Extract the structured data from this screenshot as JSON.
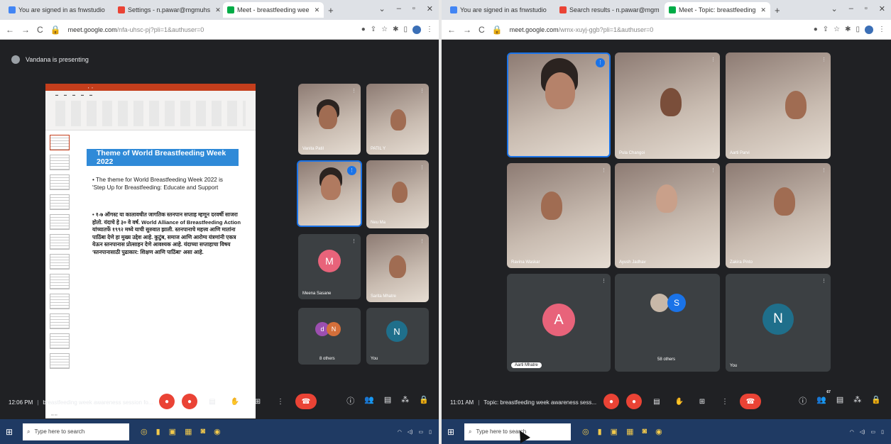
{
  "colors": {
    "meet_bg": "#202124",
    "accent": "#1a73e8",
    "end_call": "#ea4335",
    "slide_banner": "#2f8ad8",
    "taskbar": "#1f3a63"
  },
  "left": {
    "tabs": [
      {
        "label": "You are signed in as fnwstudio",
        "icon": "google-icon"
      },
      {
        "label": "Settings - n.pawar@mgmuhs",
        "icon": "gmail-icon"
      },
      {
        "label": "Meet - breastfeeding wee",
        "icon": "meet-icon"
      }
    ],
    "url": "meet.google.com",
    "url_path": "/nfa-uhsc-pj?pli=1&authuser=0",
    "presenting_text": "Vandana is presenting",
    "slide": {
      "title": "Theme of World Breastfeeding Week 2022",
      "bullet1": "• The theme for World Breastfeeding Week 2022 is 'Step Up for Breastfeeding: Educate and Support",
      "bullet2": "• १-७ ऑगस्ट या कालावधीत जागतिक स्तनपान सप्ताह म्हणून दरवर्षी साजरा होतो. यंदाचे हे ३० वे वर्ष. World Alliance of Breastfeeding Action यांच्यातर्फे १९९२ मध्ये याची सुरुवात झाली. स्तनपानाचे महत्त्व आणि मातांना पाठिंबा देणे हा मुख्य उद्देश आहे. कुटुंब, समाज आणि आरोग्य यंत्रणांनी एकत्र येऊन स्तनपानास प्रोत्साहन देणे आवश्यक आहे. यंदाच्या सप्ताहाचा विषय 'स्तनपानासाठी पुढाकार: शिक्षण आणि पाठिंबा' असा आहे."
    },
    "participants": [
      {
        "name": "Vanita Patil"
      },
      {
        "name": "PATIL Y"
      },
      {
        "name": ""
      },
      {
        "name": "Neu Ma"
      },
      {
        "name": "Meena Sasane",
        "initial": "M"
      },
      {
        "name": "Sarita Mhatre"
      },
      {
        "name": "8 others",
        "initials": [
          "d",
          "N"
        ]
      },
      {
        "name": "You",
        "initial": "N"
      }
    ],
    "time": "12:06 PM",
    "meeting_title": "breastfeeding week awareness session fo..."
  },
  "right": {
    "tabs": [
      {
        "label": "You are signed in as fnwstudio",
        "icon": "google-icon"
      },
      {
        "label": "Search results - n.pawar@mgm",
        "icon": "gmail-icon"
      },
      {
        "label": "Meet - Topic: breastfeeding",
        "icon": "meet-icon"
      }
    ],
    "url": "meet.google.com",
    "url_path": "/wmx-xuyj-ggb?pli=1&authuser=0",
    "participants": [
      {
        "name": ""
      },
      {
        "name": "Pula Changoi"
      },
      {
        "name": "Aarti Parvi"
      },
      {
        "name": "Ravina Waskar"
      },
      {
        "name": "Ayush Jadhav"
      },
      {
        "name": "Zakira Pinto"
      },
      {
        "name": "Aarti Mhatre",
        "initial": "A"
      },
      {
        "name": "58 others",
        "initial": "S"
      },
      {
        "name": "You",
        "initial": "N"
      }
    ],
    "time": "11:01 AM",
    "meeting_title": "Topic: breastfeeding week awareness sess...",
    "people_count": "67"
  },
  "taskbar": {
    "search_placeholder": "Type here to search"
  }
}
